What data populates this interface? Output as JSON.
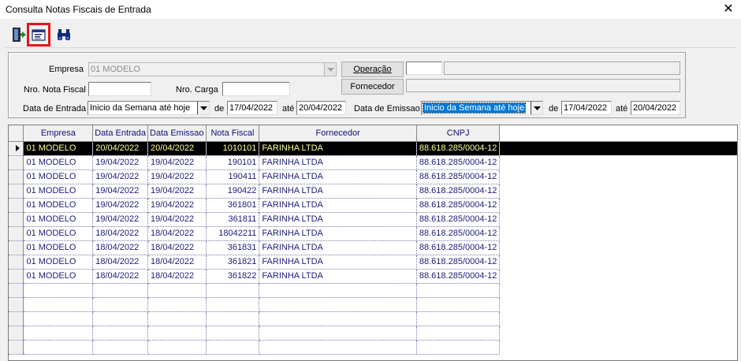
{
  "window": {
    "title": "Consulta Notas Fiscais de Entrada",
    "close_glyph": "✕"
  },
  "toolbar": {
    "buttons": [
      {
        "name": "exit-door-icon",
        "highlighted": false
      },
      {
        "name": "report-window-icon",
        "highlighted": true
      },
      {
        "name": "binoculars-icon",
        "highlighted": false
      }
    ]
  },
  "filters": {
    "empresa_label": "Empresa",
    "empresa_value": "01 MODELO",
    "nota_label": "Nro. Nota Fiscal",
    "nota_value": "",
    "carga_label": "Nro. Carga",
    "carga_value": "",
    "operacao_button": "Operação",
    "operacao_code": "",
    "operacao_desc": "",
    "fornecedor_button": "Fornecedor",
    "fornecedor_value": "",
    "data_entrada_label": "Data de Entrada",
    "data_entrada_period": "Inicio da Semana até hoje",
    "de_label": "de",
    "ate_label": "até",
    "entrada_de": "17/04/2022",
    "entrada_ate": "20/04/2022",
    "data_emissao_label": "Data de Emissao",
    "data_emissao_period": "Inicio da Semana até hoje",
    "emissao_de": "17/04/2022",
    "emissao_ate": "20/04/2022"
  },
  "grid": {
    "columns": [
      "Empresa",
      "Data Entrada",
      "Data Emissao",
      "Nota Fiscal",
      "Fornecedor",
      "CNPJ"
    ],
    "selected_row": 0,
    "empty_rows": 5,
    "rows": [
      [
        "01 MODELO",
        "20/04/2022",
        "20/04/2022",
        "1010101",
        "FARINHA LTDA",
        "88.618.285/0004-12"
      ],
      [
        "01 MODELO",
        "19/04/2022",
        "19/04/2022",
        "190101",
        "FARINHA LTDA",
        "88.618.285/0004-12"
      ],
      [
        "01 MODELO",
        "19/04/2022",
        "19/04/2022",
        "190411",
        "FARINHA LTDA",
        "88.618.285/0004-12"
      ],
      [
        "01 MODELO",
        "19/04/2022",
        "19/04/2022",
        "190422",
        "FARINHA LTDA",
        "88.618.285/0004-12"
      ],
      [
        "01 MODELO",
        "19/04/2022",
        "19/04/2022",
        "361801",
        "FARINHA LTDA",
        "88.618.285/0004-12"
      ],
      [
        "01 MODELO",
        "19/04/2022",
        "19/04/2022",
        "361811",
        "FARINHA LTDA",
        "88.618.285/0004-12"
      ],
      [
        "01 MODELO",
        "18/04/2022",
        "18/04/2022",
        "18042211",
        "FARINHA LTDA",
        "88.618.285/0004-12"
      ],
      [
        "01 MODELO",
        "18/04/2022",
        "18/04/2022",
        "361831",
        "FARINHA LTDA",
        "88.618.285/0004-12"
      ],
      [
        "01 MODELO",
        "18/04/2022",
        "18/04/2022",
        "361821",
        "FARINHA LTDA",
        "88.618.285/0004-12"
      ],
      [
        "01 MODELO",
        "18/04/2022",
        "18/04/2022",
        "361822",
        "FARINHA LTDA",
        "88.618.285/0004-12"
      ]
    ]
  },
  "colors": {
    "highlight_border": "#e4141b",
    "selection_bg": "#000000",
    "selection_text": "#ffff99",
    "grid_text": "#1d1d7a",
    "dropdown_selection": "#0078d7"
  }
}
